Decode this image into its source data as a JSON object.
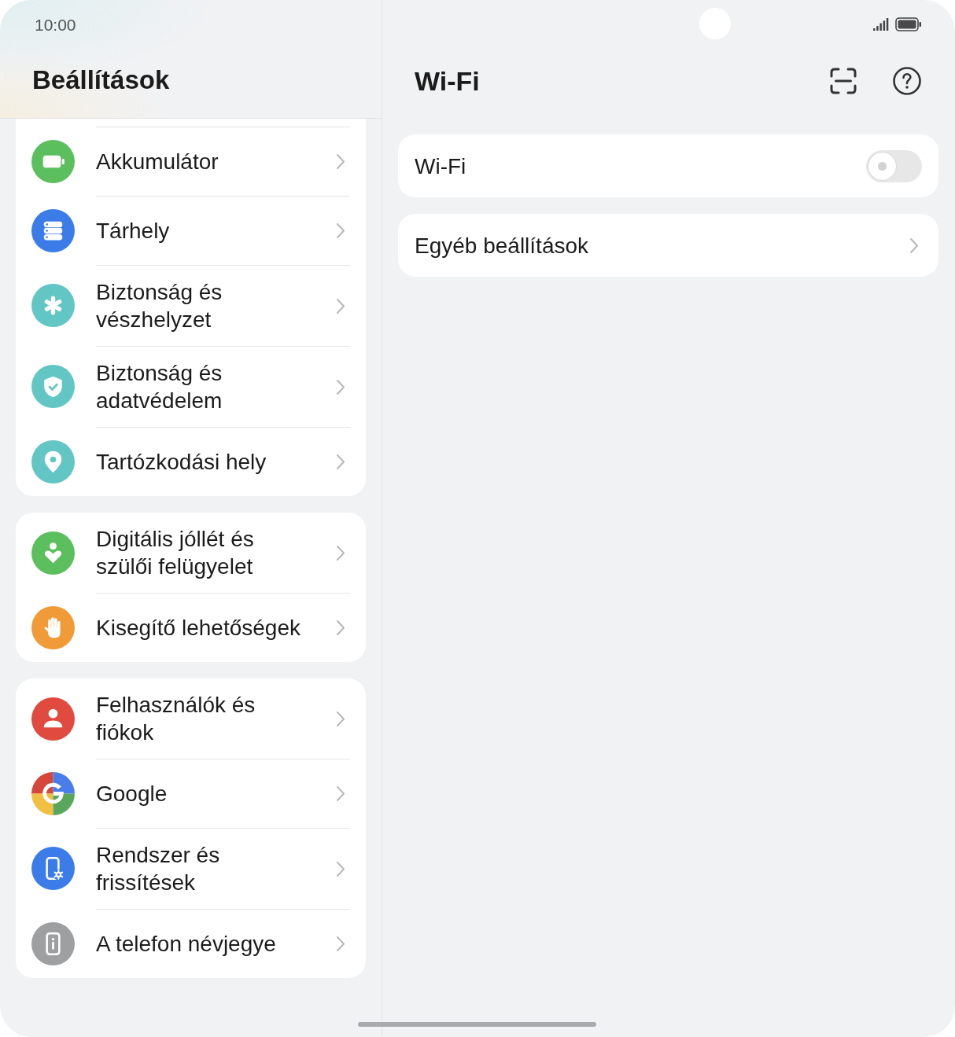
{
  "status_bar": {
    "time": "10:00"
  },
  "sidebar": {
    "title": "Beállítások",
    "groups": [
      {
        "clipped": true,
        "items": [
          {
            "label": "Akkumulátor",
            "selected": false
          },
          {
            "label": "Tárhely",
            "selected": false
          },
          {
            "label": "Biztonság és vészhelyzet",
            "selected": false
          },
          {
            "label": "Biztonság és adatvédelem",
            "selected": false
          },
          {
            "label": "Tartózkodási hely",
            "selected": false
          }
        ]
      },
      {
        "clipped": false,
        "items": [
          {
            "label": "Digitális jóllét és szülői felügyelet",
            "selected": false
          },
          {
            "label": "Kisegítő lehetőségek",
            "selected": false
          }
        ]
      },
      {
        "clipped": false,
        "items": [
          {
            "label": "Felhasználók és fiókok",
            "selected": false
          },
          {
            "label": "Google",
            "selected": false
          },
          {
            "label": "Rendszer és frissítések",
            "selected": false
          },
          {
            "label": "A telefon névjegye",
            "selected": false
          }
        ]
      }
    ]
  },
  "detail": {
    "title": "Wi-Fi",
    "rows": [
      {
        "kind": "toggle",
        "label": "Wi-Fi",
        "on": false
      },
      {
        "kind": "link",
        "label": "Egyéb beállítások"
      }
    ]
  }
}
